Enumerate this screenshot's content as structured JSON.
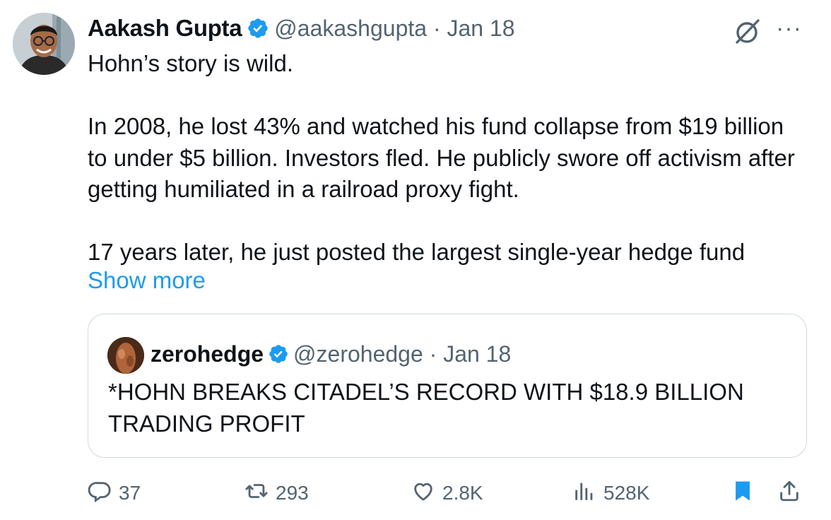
{
  "author": {
    "name": "Aakash Gupta",
    "handle": "@aakashgupta",
    "date": "Jan 18",
    "handle_date": "@aakashgupta · Jan 18"
  },
  "tweet": {
    "text": "Hohn’s story is wild.\n\nIn 2008, he lost 43% and watched his fund collapse from $19 billion to under $5 billion. Investors fled. He publicly swore off activism after getting humiliated in a railroad proxy fight.\n\n17 years later, he just posted the largest single-year hedge fund",
    "show_more": "Show more"
  },
  "quote": {
    "name": "zerohedge",
    "handle_date": "@zerohedge · Jan 18",
    "text": "*HOHN BREAKS CITADEL’S RECORD WITH $18.9 BILLION TRADING PROFIT"
  },
  "actions": {
    "replies": "37",
    "reposts": "293",
    "likes": "2.8K",
    "views": "528K"
  },
  "icons": {
    "verified": "verified-badge-icon",
    "grok": "grok-icon",
    "more": "more-icon",
    "reply": "reply-icon",
    "repost": "repost-icon",
    "like": "heart-icon",
    "views": "views-icon",
    "bookmark": "bookmark-icon",
    "share": "share-icon"
  },
  "colors": {
    "accent": "#1d9bf0",
    "secondary_text": "#536471",
    "border": "#cfd9de"
  }
}
